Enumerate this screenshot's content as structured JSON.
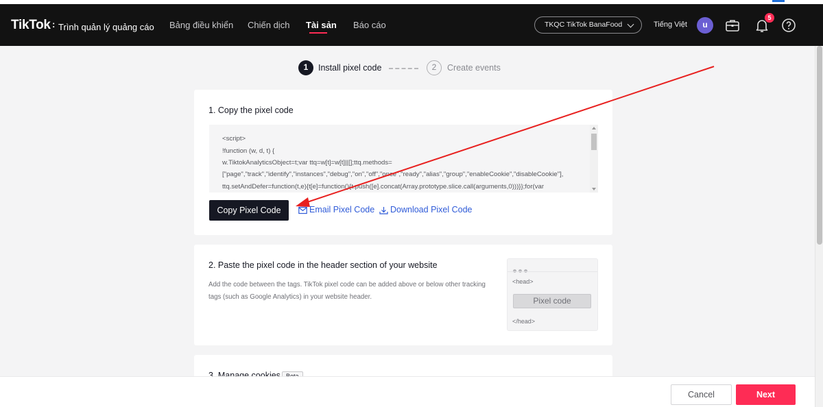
{
  "header": {
    "logo": "TikTok",
    "logo_colon": ":",
    "app_title": "Trình quản lý quảng cáo",
    "nav": [
      {
        "label": "Bảng điều khiển",
        "active": false
      },
      {
        "label": "Chiến dịch",
        "active": false
      },
      {
        "label": "Tài sản",
        "active": true
      },
      {
        "label": "Báo cáo",
        "active": false
      }
    ],
    "account": "TKQC TikTok BanaFood",
    "language": "Tiếng Việt",
    "avatar_initial": "u",
    "notifications_count": "5",
    "icons": [
      "briefcase-icon",
      "bell-icon",
      "help-icon"
    ]
  },
  "stepper": {
    "steps": [
      {
        "number": "1",
        "label": "Install pixel code",
        "active": true
      },
      {
        "number": "2",
        "label": "Create events",
        "active": false
      }
    ]
  },
  "section1": {
    "title": "1. Copy the pixel code",
    "code_lines": [
      "<script>",
      "!function (w, d, t) {",
      "  w.TiktokAnalyticsObject=t;var ttq=w[t]=w[t]||[];ttq.methods=",
      "[\"page\",\"track\",\"identify\",\"instances\",\"debug\",\"on\",\"off\",\"once\",\"ready\",\"alias\",\"group\",\"enableCookie\",\"disableCookie\"],",
      "ttq.setAndDefer=function(t,e){t[e]=function(){t.push([e].concat(Array.prototype.slice.call(arguments,0)))}};for(var"
    ],
    "copy_button": "Copy Pixel Code",
    "email_link": "Email Pixel Code",
    "download_link": "Download Pixel Code"
  },
  "section2": {
    "title": "2. Paste the pixel code in the header section of your website",
    "description": "Add the code between the tags. TikTok pixel code can be added above or below other tracking tags (such as Google Analytics) in your website header.",
    "preview": {
      "open_tag": "<head>",
      "pixel_label": "Pixel code",
      "close_tag": "</head>"
    }
  },
  "section3": {
    "title": "3. Manage cookies",
    "badge": "Beta"
  },
  "footer": {
    "cancel": "Cancel",
    "next": "Next"
  },
  "colors": {
    "brand_red": "#fe2c55",
    "nav_bg": "#121212",
    "link_blue": "#2f5bd8",
    "annotation_arrow": "#e8201f"
  }
}
